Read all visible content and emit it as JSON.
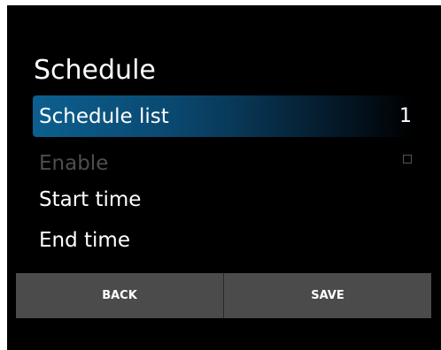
{
  "header": {
    "title": "Schedule"
  },
  "list": {
    "items": [
      {
        "label": "Schedule list",
        "value": "1",
        "state": "selected"
      },
      {
        "label": "Enable",
        "checked": false,
        "state": "disabled"
      },
      {
        "label": "Start time",
        "state": "normal"
      },
      {
        "label": "End time",
        "state": "normal"
      }
    ]
  },
  "buttons": {
    "back_label": "BACK",
    "save_label": "SAVE"
  },
  "colors": {
    "background": "#000000",
    "selection": "#0c5f8f",
    "button": "#4b4b4b",
    "disabled_text": "#4e4e4e"
  }
}
